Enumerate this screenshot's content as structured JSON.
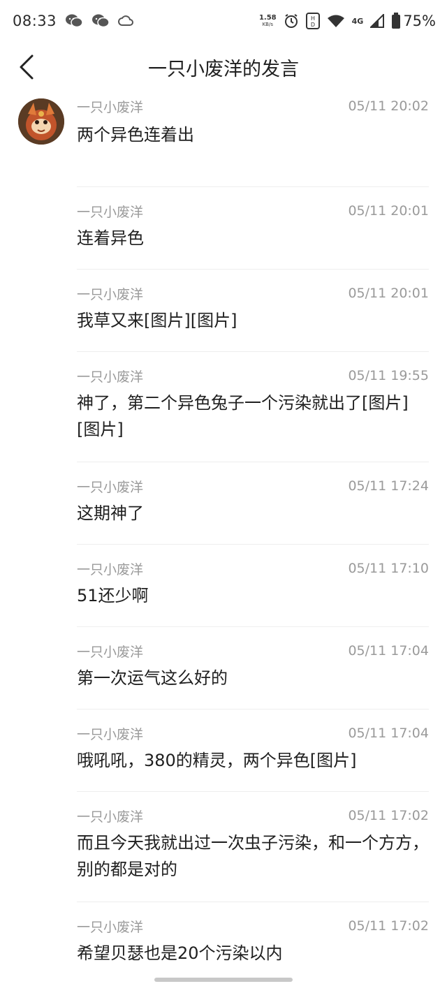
{
  "status_bar": {
    "time": "08:33",
    "net_speed_value": "1.58",
    "net_speed_unit": "KB/s",
    "network_type": "4G",
    "battery": "75%",
    "icons": [
      "wechat-icon",
      "wechat-icon",
      "cloud-icon",
      "alarm-icon",
      "hd-icon",
      "wifi-icon",
      "signal-icon",
      "battery-icon"
    ]
  },
  "header": {
    "back_icon": "back-arrow-icon",
    "title": "一只小废洋的发言"
  },
  "posts": [
    {
      "author": "一只小废洋",
      "time": "05/11 20:02",
      "text": "两个异色连着出"
    },
    {
      "author": "一只小废洋",
      "time": "05/11 20:01",
      "text": "连着异色"
    },
    {
      "author": "一只小废洋",
      "time": "05/11 20:01",
      "text": "我草又来[图片][图片]"
    },
    {
      "author": "一只小废洋",
      "time": "05/11 19:55",
      "text": "神了，第二个异色兔子一个污染就出了[图片][图片]"
    },
    {
      "author": "一只小废洋",
      "time": "05/11 17:24",
      "text": "这期神了"
    },
    {
      "author": "一只小废洋",
      "time": "05/11 17:10",
      "text": "51还少啊"
    },
    {
      "author": "一只小废洋",
      "time": "05/11 17:04",
      "text": "第一次运气这么好的"
    },
    {
      "author": "一只小废洋",
      "time": "05/11 17:04",
      "text": "哦吼吼，380的精灵，两个异色[图片]"
    },
    {
      "author": "一只小废洋",
      "time": "05/11 17:02",
      "text": "而且今天我就出过一次虫子污染，和一个方方，别的都是对的"
    },
    {
      "author": "一只小废洋",
      "time": "05/11 17:02",
      "text": "希望贝瑟也是20个污染以内"
    }
  ]
}
